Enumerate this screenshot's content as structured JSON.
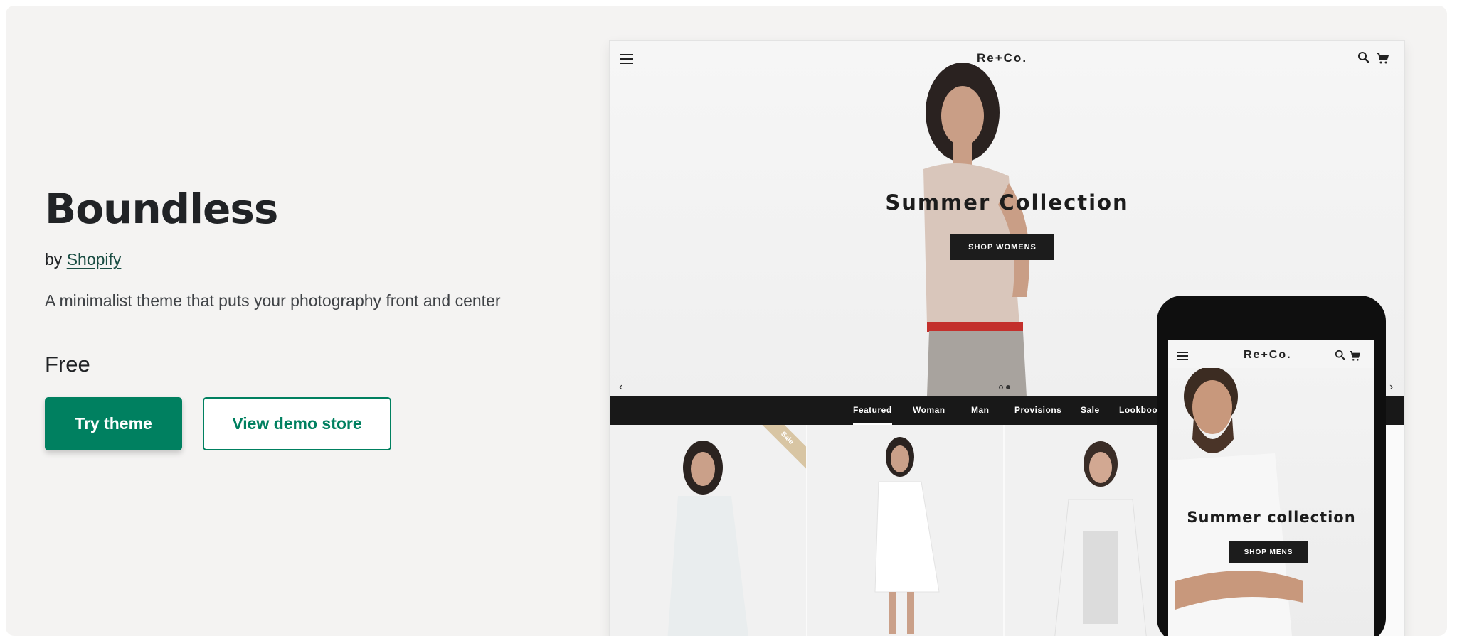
{
  "theme": {
    "title": "Boundless",
    "by_prefix": "by ",
    "author": "Shopify",
    "description": "A minimalist theme that puts your photography front and center",
    "price": "Free",
    "try_button": "Try theme",
    "demo_button": "View demo store"
  },
  "desktop_preview": {
    "logo": "Re+Co.",
    "hero_title": "Summer Collection",
    "hero_button": "SHOP WOMENS",
    "prev_arrow": "‹",
    "next_arrow": "›",
    "nav": [
      "Featured",
      "Woman",
      "Man",
      "Provisions",
      "Sale",
      "Lookbook"
    ],
    "sale_badge": "Sale"
  },
  "mobile_preview": {
    "logo": "Re+Co.",
    "hero_title": "Summer collection",
    "hero_button": "SHOP MENS"
  },
  "colors": {
    "accent": "#008060",
    "background": "#f4f3f2",
    "nav_bar": "#181818"
  }
}
